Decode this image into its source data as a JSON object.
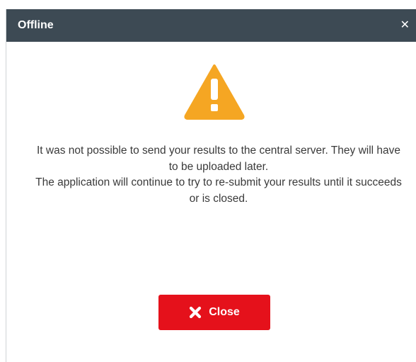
{
  "dialog": {
    "title": "Offline",
    "close_icon": "close-icon",
    "warning_icon": "warning-triangle-icon",
    "message_lines": [
      "It was not possible to send your results to the central server. They will have to be uploaded later.",
      "The application will continue to try to re-submit your results until it succeeds or is closed."
    ],
    "close_button_label": "Close",
    "close_button_icon": "x-icon"
  },
  "colors": {
    "titlebar": "#3d4a54",
    "warning": "#f5a623",
    "close_button": "#e5111b"
  }
}
